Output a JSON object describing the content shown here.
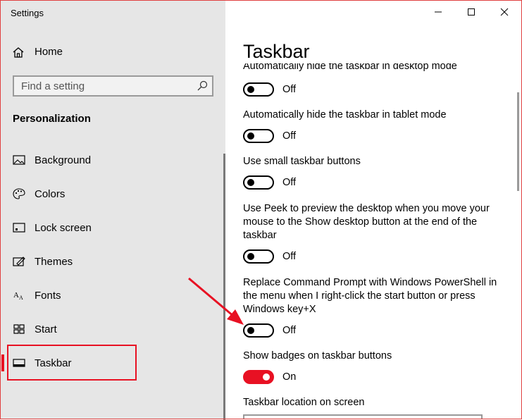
{
  "window": {
    "title": "Settings"
  },
  "sidebar": {
    "home_label": "Home",
    "search": {
      "placeholder": "Find a setting"
    },
    "section_heading": "Personalization",
    "items": [
      {
        "label": "Background",
        "icon": "picture-icon"
      },
      {
        "label": "Colors",
        "icon": "palette-icon"
      },
      {
        "label": "Lock screen",
        "icon": "lock-screen-icon"
      },
      {
        "label": "Themes",
        "icon": "themes-icon"
      },
      {
        "label": "Fonts",
        "icon": "fonts-icon"
      },
      {
        "label": "Start",
        "icon": "start-icon"
      },
      {
        "label": "Taskbar",
        "icon": "taskbar-icon",
        "selected": true
      }
    ]
  },
  "main": {
    "title": "Taskbar",
    "settings": [
      {
        "label": "Automatically hide the taskbar in desktop mode",
        "state": "Off"
      },
      {
        "label": "Automatically hide the taskbar in tablet mode",
        "state": "Off"
      },
      {
        "label": "Use small taskbar buttons",
        "state": "Off"
      },
      {
        "label": "Use Peek to preview the desktop when you move your mouse to the Show desktop button at the end of the taskbar",
        "state": "Off"
      },
      {
        "label": "Replace Command Prompt with Windows PowerShell in the menu when I right-click the start button or press Windows key+X",
        "state": "Off"
      },
      {
        "label": "Show badges on taskbar buttons",
        "state": "On"
      }
    ],
    "location_label": "Taskbar location on screen"
  },
  "colors": {
    "accent": "#e81123",
    "sidebar_bg": "#e6e6e6",
    "annotation": "#e81123"
  }
}
